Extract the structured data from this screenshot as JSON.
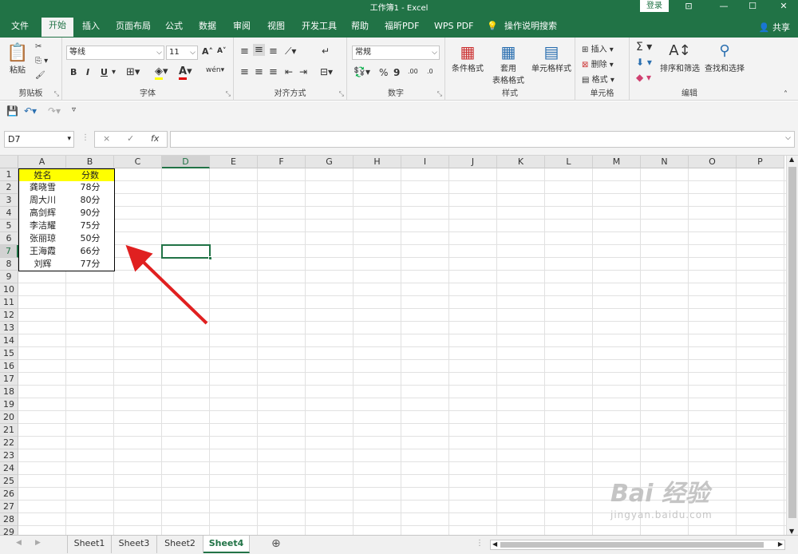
{
  "window": {
    "title": "工作簿1  -  Excel",
    "login_label": "登录",
    "share_label": "共享"
  },
  "tabs": [
    "文件",
    "开始",
    "插入",
    "页面布局",
    "公式",
    "数据",
    "审阅",
    "视图",
    "开发工具",
    "帮助",
    "福昕PDF",
    "WPS PDF",
    "操作说明搜索"
  ],
  "active_tab": "开始",
  "ribbon": {
    "clipboard": {
      "label": "剪贴板",
      "paste": "粘贴"
    },
    "font": {
      "label": "字体",
      "name": "等线",
      "size": "11",
      "grow": "A",
      "shrink": "A",
      "bold": "B",
      "italic": "I",
      "underline": "U",
      "phonetic": "wén"
    },
    "alignment": {
      "label": "对齐方式"
    },
    "number": {
      "label": "数字",
      "format": "常规",
      "percent": "%",
      "comma": "9",
      "dec_inc": ".00",
      "dec_dec": ".0"
    },
    "styles": {
      "label": "样式",
      "cond_format": "条件格式",
      "table_format_1": "套用",
      "table_format_2": "表格格式",
      "cell_styles": "单元格样式"
    },
    "cells": {
      "label": "单元格",
      "insert": "插入",
      "delete": "删除",
      "format": "格式"
    },
    "editing": {
      "label": "编辑",
      "sort_filter": "排序和筛选",
      "find_select": "查找和选择"
    }
  },
  "formula_bar": {
    "name_box": "D7",
    "cancel": "×",
    "enter": "✓",
    "fx": "fx",
    "value": ""
  },
  "columns": [
    "A",
    "B",
    "C",
    "D",
    "E",
    "F",
    "G",
    "H",
    "I",
    "J",
    "K",
    "L",
    "M",
    "N",
    "O",
    "P"
  ],
  "rows": [
    "1",
    "2",
    "3",
    "4",
    "5",
    "6",
    "7",
    "8",
    "9",
    "10",
    "11",
    "12",
    "13",
    "14",
    "15",
    "16",
    "17",
    "18",
    "19",
    "20",
    "21",
    "22",
    "23",
    "24",
    "25",
    "26",
    "27",
    "28",
    "29"
  ],
  "selected_cell": {
    "col": "D",
    "row": "7"
  },
  "table": {
    "headers": [
      "姓名",
      "分数"
    ],
    "rows": [
      [
        "龚晓雪",
        "78分"
      ],
      [
        "周大川",
        "80分"
      ],
      [
        "高剑辉",
        "90分"
      ],
      [
        "李洁耀",
        "75分"
      ],
      [
        "张丽琼",
        "50分"
      ],
      [
        "王海霞",
        "66分"
      ],
      [
        "刘辉",
        "77分"
      ]
    ]
  },
  "sheets": [
    "Sheet1",
    "Sheet3",
    "Sheet2",
    "Sheet4"
  ],
  "active_sheet": "Sheet4",
  "watermark": {
    "brand": "Bai 经验",
    "url": "jingyan.baidu.com"
  },
  "colors": {
    "accent": "#217346",
    "header_fill": "#ffff00",
    "arrow": "#e02020"
  }
}
